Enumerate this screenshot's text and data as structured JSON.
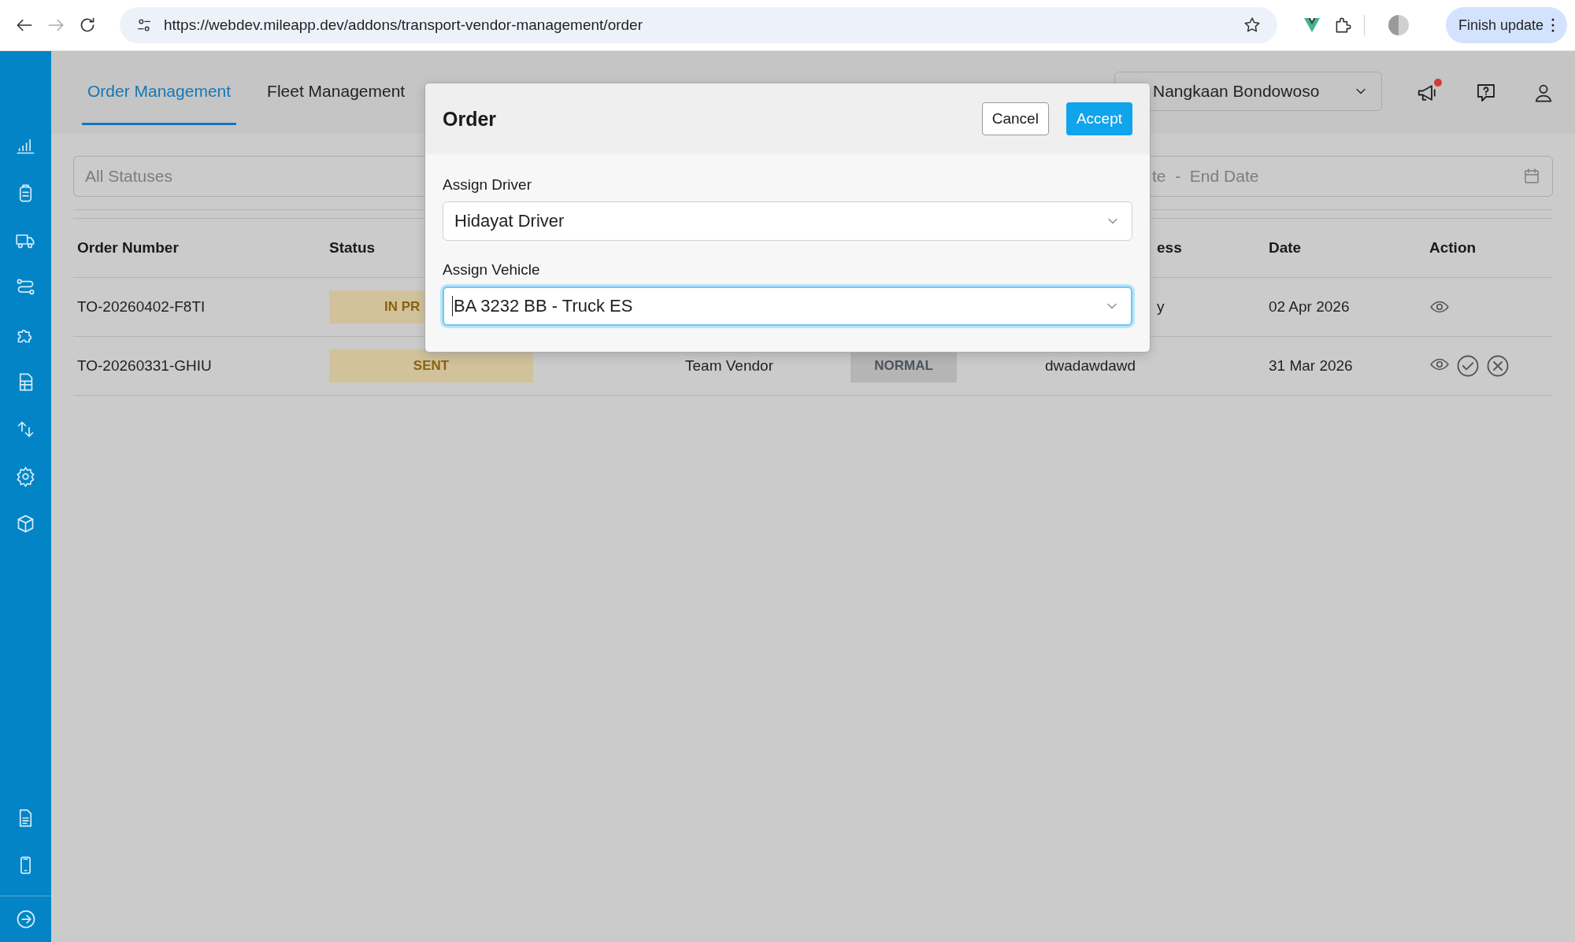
{
  "browser": {
    "url": "https://webdev.mileapp.dev/addons/transport-vendor-management/order",
    "forward_disabled": true,
    "update_button": "Finish update"
  },
  "tabs": [
    {
      "label": "Order Management",
      "selected": true
    },
    {
      "label": "Fleet Management",
      "selected": false
    }
  ],
  "location_select": {
    "value": "Nangkaan Bondowoso"
  },
  "notifications": {
    "unread": true
  },
  "filters": {
    "status_placeholder": "All Statuses",
    "date_placeholder": "te  -  End Date"
  },
  "table": {
    "columns": [
      {
        "kind": "order",
        "label": "Order Number"
      },
      {
        "kind": "status",
        "label": "Status"
      },
      {
        "kind": "address",
        "label": "ess"
      },
      {
        "kind": "date",
        "label": "Date"
      },
      {
        "kind": "action",
        "label": "Action"
      }
    ],
    "rows": [
      {
        "order_number": "TO-20260402-F8TI",
        "status": "IN PR",
        "address": "y",
        "date": "02 Apr 2026",
        "actions": [
          {
            "kind": "view"
          }
        ]
      },
      {
        "order_number": "TO-20260331-GHIU",
        "status": "SENT",
        "vendor": "Team Vendor",
        "priority": "NORMAL",
        "address": "dwadawdawd",
        "date": "31 Mar 2026",
        "actions": [
          {
            "kind": "view"
          },
          {
            "kind": "accept"
          },
          {
            "kind": "reject"
          }
        ]
      }
    ]
  },
  "modal": {
    "title": "Order",
    "buttons": [
      {
        "kind": "secondary",
        "label": "Cancel"
      },
      {
        "kind": "primary",
        "label": "Accept"
      }
    ],
    "fields": [
      {
        "label": "Assign Driver",
        "value": "Hidayat Driver",
        "focused": false
      },
      {
        "label": "Assign Vehicle",
        "value": "BA 3232 BB - Truck ES",
        "focused": true
      }
    ]
  }
}
